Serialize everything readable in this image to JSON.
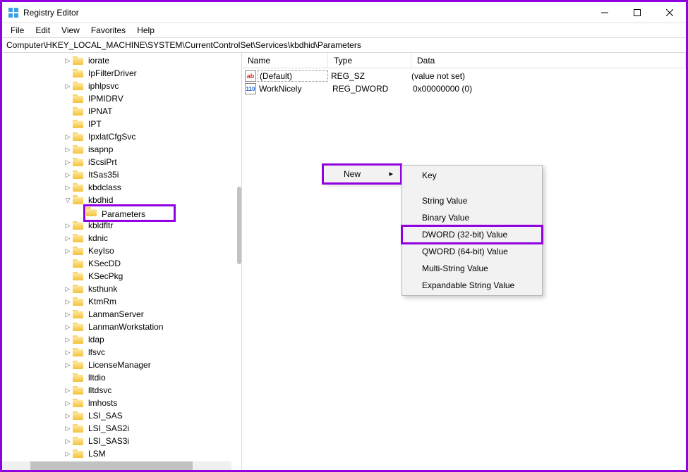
{
  "window": {
    "title": "Registry Editor"
  },
  "menubar": [
    "File",
    "Edit",
    "View",
    "Favorites",
    "Help"
  ],
  "address": "Computer\\HKEY_LOCAL_MACHINE\\SYSTEM\\CurrentControlSet\\Services\\kbdhid\\Parameters",
  "tree": [
    {
      "depth": 0,
      "exp": ">",
      "name": "iorate"
    },
    {
      "depth": 0,
      "noexp": true,
      "name": "IpFilterDriver"
    },
    {
      "depth": 0,
      "exp": ">",
      "name": "iphlpsvc"
    },
    {
      "depth": 0,
      "noexp": true,
      "name": "IPMIDRV"
    },
    {
      "depth": 0,
      "noexp": true,
      "name": "IPNAT"
    },
    {
      "depth": 0,
      "noexp": true,
      "name": "IPT"
    },
    {
      "depth": 0,
      "exp": ">",
      "name": "IpxlatCfgSvc"
    },
    {
      "depth": 0,
      "exp": ">",
      "name": "isapnp"
    },
    {
      "depth": 0,
      "exp": ">",
      "name": "iScsiPrt"
    },
    {
      "depth": 0,
      "exp": ">",
      "name": "ItSas35i"
    },
    {
      "depth": 0,
      "exp": ">",
      "name": "kbdclass"
    },
    {
      "depth": 0,
      "exp": "v",
      "name": "kbdhid"
    },
    {
      "depth": 1,
      "noexp": true,
      "name": "Parameters",
      "selected": true
    },
    {
      "depth": 0,
      "exp": ">",
      "name": "kbldfltr"
    },
    {
      "depth": 0,
      "exp": ">",
      "name": "kdnic"
    },
    {
      "depth": 0,
      "exp": ">",
      "name": "KeyIso"
    },
    {
      "depth": 0,
      "noexp": true,
      "name": "KSecDD"
    },
    {
      "depth": 0,
      "noexp": true,
      "name": "KSecPkg"
    },
    {
      "depth": 0,
      "exp": ">",
      "name": "ksthunk"
    },
    {
      "depth": 0,
      "exp": ">",
      "name": "KtmRm"
    },
    {
      "depth": 0,
      "exp": ">",
      "name": "LanmanServer"
    },
    {
      "depth": 0,
      "exp": ">",
      "name": "LanmanWorkstation"
    },
    {
      "depth": 0,
      "exp": ">",
      "name": "ldap"
    },
    {
      "depth": 0,
      "exp": ">",
      "name": "lfsvc"
    },
    {
      "depth": 0,
      "exp": ">",
      "name": "LicenseManager"
    },
    {
      "depth": 0,
      "noexp": true,
      "name": "lltdio"
    },
    {
      "depth": 0,
      "exp": ">",
      "name": "lltdsvc"
    },
    {
      "depth": 0,
      "exp": ">",
      "name": "lmhosts"
    },
    {
      "depth": 0,
      "exp": ">",
      "name": "LSI_SAS"
    },
    {
      "depth": 0,
      "exp": ">",
      "name": "LSI_SAS2i"
    },
    {
      "depth": 0,
      "exp": ">",
      "name": "LSI_SAS3i"
    },
    {
      "depth": 0,
      "exp": ">",
      "name": "LSM"
    }
  ],
  "columns": {
    "name": "Name",
    "type": "Type",
    "data": "Data"
  },
  "values": [
    {
      "icon": "ab",
      "name": "(Default)",
      "type": "REG_SZ",
      "data": "(value not set)",
      "boxed": true
    },
    {
      "icon": "bin",
      "name": "WorkNicely",
      "type": "REG_DWORD",
      "data": "0x00000000 (0)"
    }
  ],
  "context": {
    "new_label": "New",
    "items": [
      {
        "label": "Key"
      },
      {
        "label": "String Value"
      },
      {
        "label": "Binary Value"
      },
      {
        "label": "DWORD (32-bit) Value",
        "hl": true
      },
      {
        "label": "QWORD (64-bit) Value"
      },
      {
        "label": "Multi-String Value"
      },
      {
        "label": "Expandable String Value"
      }
    ]
  }
}
